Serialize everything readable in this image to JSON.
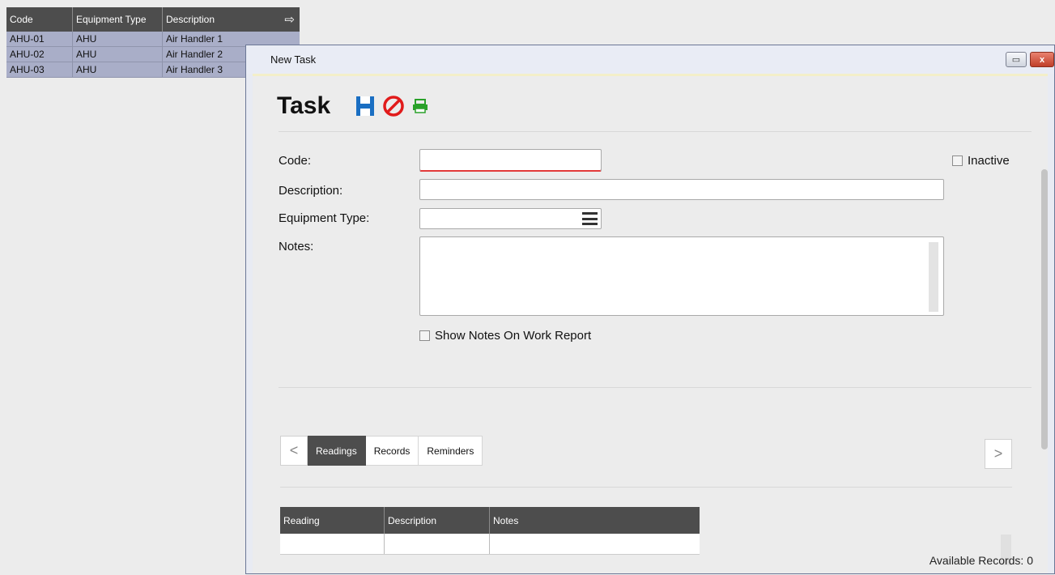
{
  "background_grid": {
    "columns": [
      "Code",
      "Equipment Type",
      "Description"
    ],
    "rows": [
      [
        "AHU-01",
        "AHU",
        "Air Handler 1"
      ],
      [
        "AHU-02",
        "AHU",
        "Air Handler 2"
      ],
      [
        "AHU-03",
        "AHU",
        "Air Handler 3"
      ]
    ]
  },
  "window": {
    "title": "New Task",
    "restore_glyph": "▭",
    "close_glyph": "x"
  },
  "header": {
    "title": "Task",
    "icons": [
      "save-icon",
      "cancel-icon",
      "print-icon"
    ]
  },
  "colors": {
    "save": "#1a6ec2",
    "cancel": "#e11b1b",
    "print": "#2aa12a",
    "accent_underline": "#e23a3a"
  },
  "form": {
    "code_label": "Code:",
    "code_value": "",
    "description_label": "Description:",
    "description_value": "",
    "equipment_type_label": "Equipment Type:",
    "equipment_type_value": "",
    "notes_label": "Notes:",
    "notes_value": "",
    "inactive_label": "Inactive",
    "show_notes_label": "Show Notes On Work Report"
  },
  "tabs": {
    "prev": "<",
    "next": ">",
    "items": [
      "Readings",
      "Records",
      "Reminders"
    ]
  },
  "readings_grid": {
    "columns": [
      "Reading",
      "Description",
      "Notes"
    ]
  },
  "footer": {
    "available_records": "Available Records:  0"
  }
}
